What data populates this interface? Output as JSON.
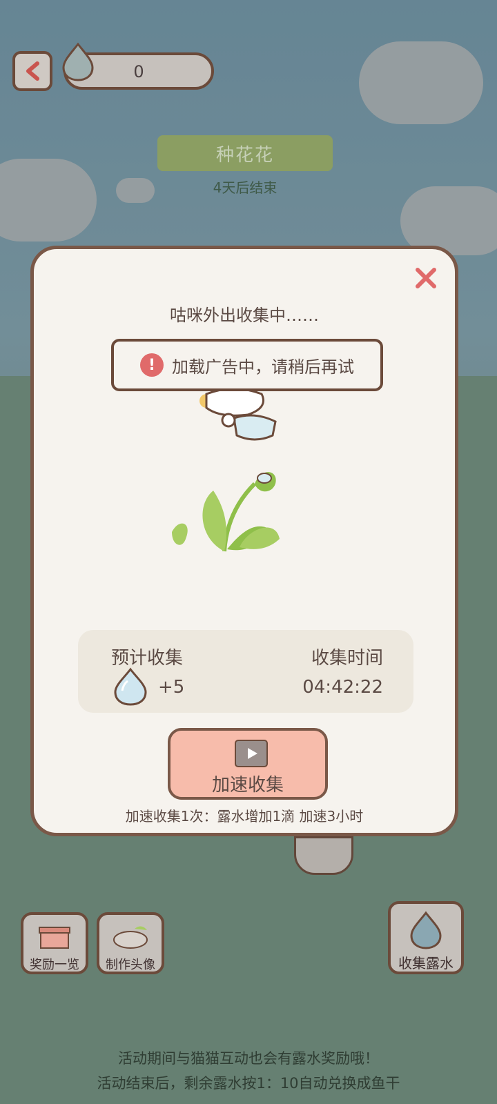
{
  "header": {
    "dew_count": "0"
  },
  "event": {
    "title": "种花花",
    "subtitle": "4天后结束"
  },
  "modal": {
    "heading": "咕咪外出收集中……",
    "toast": "加载广告中，请稍后再试",
    "expected_label": "预计收集",
    "expected_value": "+5",
    "time_label": "收集时间",
    "time_value": "04:42:22",
    "speed_button": "加速收集",
    "speed_note": "加速收集1次：露水增加1滴 加速3小时"
  },
  "bottom": {
    "rewards_label": "奖励一览",
    "avatar_label": "制作头像",
    "collect_label": "收集露水",
    "note_line1": "活动期间与猫猫互动也会有露水奖励哦！",
    "note_line2": "活动结束后，剩余露水按1：10自动兑换成鱼干"
  },
  "colors": {
    "accent": "#f7bcab",
    "warn": "#e06a6a",
    "leaf": "#8fbf4a",
    "border": "#7a5848"
  }
}
